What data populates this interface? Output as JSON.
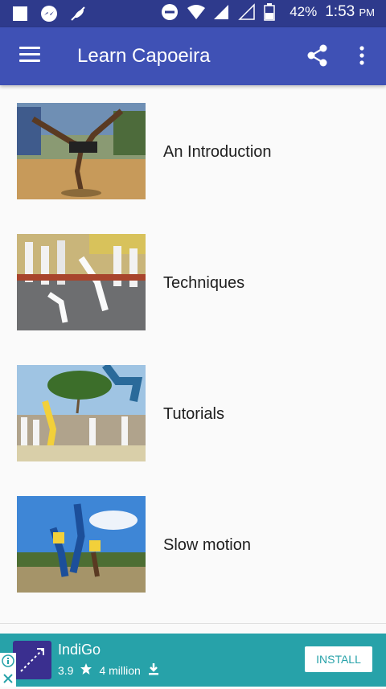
{
  "status_bar": {
    "battery": "42%",
    "time": "1:53",
    "ampm": "PM"
  },
  "app_bar": {
    "title": "Learn Capoeira"
  },
  "items": [
    {
      "label": "An Introduction",
      "image_name": "capoeira-kick-photo"
    },
    {
      "label": "Techniques",
      "image_name": "capoeira-roda-photo"
    },
    {
      "label": "Tutorials",
      "image_name": "capoeira-beach-photo"
    },
    {
      "label": "Slow motion",
      "image_name": "capoeira-duo-photo"
    }
  ],
  "ad": {
    "app_name": "IndiGo",
    "rating": "3.9",
    "downloads": "4 million",
    "install_label": "INSTALL"
  },
  "colors": {
    "app_bar": "#3f51b5",
    "status_bar": "#2e3a8c",
    "ad_background": "#27a2a9"
  }
}
